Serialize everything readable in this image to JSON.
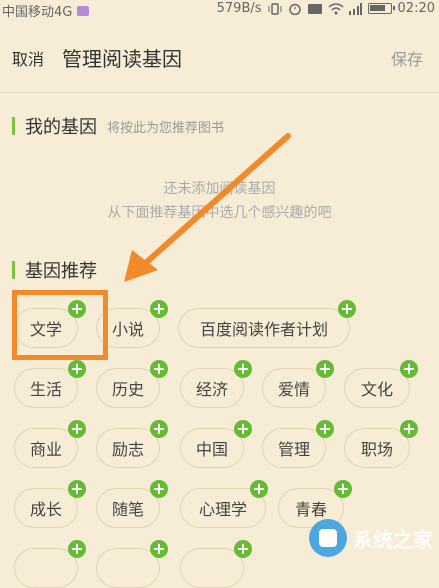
{
  "status": {
    "carrier": "中国移动4G",
    "speed": "579B/s",
    "time": "02:20"
  },
  "header": {
    "cancel_label": "取消",
    "title": "管理阅读基因",
    "save_label": "保存"
  },
  "my_genes": {
    "title": "我的基因",
    "subtitle": "将按此为您推荐图书",
    "empty_line1": "还未添加阅读基因",
    "empty_line2": "从下面推荐基因中选几个感兴趣的吧"
  },
  "recommend": {
    "title": "基因推荐",
    "tags": [
      "文学",
      "小说",
      "百度阅读作者计划",
      "生活",
      "历史",
      "经济",
      "爱情",
      "文化",
      "商业",
      "励志",
      "中国",
      "管理",
      "职场",
      "成长",
      "随笔",
      "心理学",
      "青春"
    ]
  },
  "watermark": {
    "text": "系统之家"
  },
  "colors": {
    "background": "#f7ecd5",
    "accent_green": "#66bb35",
    "highlight_orange": "#f08a2a"
  }
}
